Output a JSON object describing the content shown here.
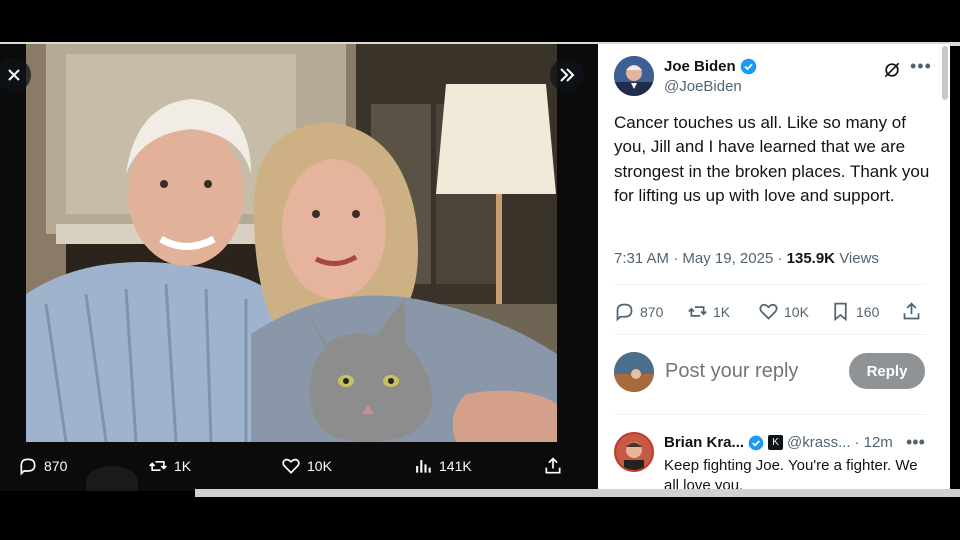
{
  "media_viewer": {
    "close_icon": "close-icon",
    "expand_icon": "chevron-double-right-icon",
    "actions": {
      "replies": "870",
      "reposts": "1K",
      "likes": "10K",
      "views": "141K"
    }
  },
  "tweet": {
    "author_name": "Joe Biden",
    "author_handle": "@JoeBiden",
    "text": "Cancer touches us all. Like so many of you, Jill and I have learned that we are strongest in the broken places. Thank you for lifting us up with love and support.",
    "time": "7:31 AM",
    "date": "May 19, 2025",
    "views_count": "135.9K",
    "views_label": "Views",
    "stats": {
      "replies": "870",
      "reposts": "1K",
      "likes": "10K",
      "bookmarks": "160"
    }
  },
  "reply_box": {
    "placeholder": "Post your reply",
    "button_label": "Reply"
  },
  "comment": {
    "name": "Brian Kra...",
    "handle": "@krass...",
    "time": "12m",
    "text": "Keep fighting Joe. You're a fighter. We all love you."
  },
  "colors": {
    "verified_blue": "#1d9bf0",
    "text_primary": "#0f1419",
    "text_secondary": "#536471",
    "reply_button": "#8f9396"
  }
}
